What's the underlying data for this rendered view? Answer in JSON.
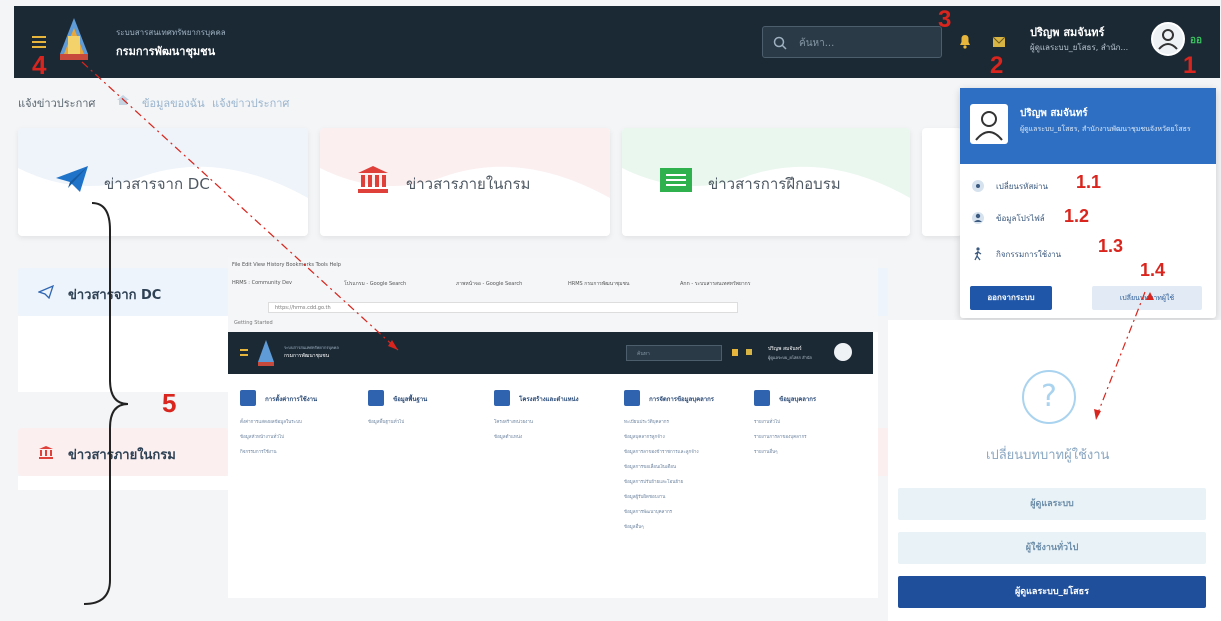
{
  "topbar": {
    "org_sub": "ระบบสารสนเทศทรัพยากรบุคคล",
    "org_name": "กรมการพัฒนาชุมชน",
    "search_placeholder": "ค้นหา...",
    "user_name": "ปริญพ สมจันทร์",
    "user_role": "ผู้ดูแลระบบ_ยโสธร, สำนัก...",
    "online_badge": "ออ"
  },
  "breadcrumb": {
    "current": "แจ้งข่าวประกาศ",
    "items": [
      "ข้อมูลของฉัน",
      "แจ้งข่าวประกาศ"
    ]
  },
  "cards": [
    {
      "label": "ข่าวสารจาก DC",
      "icon": "paper-plane-icon",
      "color": "#1f73c9"
    },
    {
      "label": "ข่าวสารภายในกรม",
      "icon": "bank-icon",
      "color": "#e0403a"
    },
    {
      "label": "ข่าวสารการฝึกอบรม",
      "icon": "list-icon",
      "color": "#2fb24d"
    }
  ],
  "panels": [
    {
      "label": "ข่าวสารจาก DC"
    },
    {
      "label": "ข่าวสารภายในกรม"
    }
  ],
  "dropdown": {
    "name": "ปริญพ สมจันทร์",
    "org": "ผู้ดูแลระบบ_ยโสธร, สำนักงานพัฒนาชุมชนจังหวัดยโสธร",
    "items": [
      {
        "label": "เปลี่ยนรหัสผ่าน",
        "icon": "gear-icon"
      },
      {
        "label": "ข้อมูลโปรไฟล์",
        "icon": "user-icon"
      },
      {
        "label": "กิจกรรมการใช้งาน",
        "icon": "walk-icon"
      }
    ],
    "logout": "ออกจากระบบ",
    "switch_role": "เปลี่ยนบทบาทผู้ใช้"
  },
  "role_panel": {
    "title": "เปลี่ยนบทบาทผู้ใช้งาน",
    "roles": [
      "ผู้ดูแลระบบ",
      "ผู้ใช้งานทั่วไป",
      "ผู้ดูแลระบบ_ยโสธร"
    ],
    "active_index": 2
  },
  "inner_screenshot": {
    "browser_menu": "File  Edit  View  History  Bookmarks  Tools  Help",
    "tabs": [
      "HRMS : Community Dev",
      "โปรแกรม - Google Search",
      "ภาพหน้าจอ - Google Search",
      "HRMS กรมการพัฒนาชุมชน",
      "Ann - ระบบสารสนเทศทรัพยากร"
    ],
    "url": "https://hrms.cdd.go.th",
    "bookmark": "Getting Started",
    "org_sub": "ระบบสารสนเทศทรัพยากรบุคคล",
    "org_name": "กรมการพัฒนาชุมชน",
    "search_placeholder": "ค้นหา",
    "user_name": "ปริญพ สมจันทร์",
    "user_role": "ผู้ดูแลระบบ_ยโสธร สำนัก",
    "menus": [
      {
        "head": "การตั้งค่าการใช้งาน",
        "items": [
          "ตั้งค่าการแสดงผลข้อมูลในระบบ",
          "ข้อมูลหัวหน้างานทั่วไป",
          "กิจกรรมการใช้งาน"
        ]
      },
      {
        "head": "ข้อมูลพื้นฐาน",
        "items": [
          "ข้อมูลพื้นฐานทั่วไป"
        ]
      },
      {
        "head": "โครงสร้างและตำแหน่ง",
        "items": [
          "โครงสร้างหน่วยงาน",
          "ข้อมูลตำแหน่ง"
        ]
      },
      {
        "head": "การจัดการข้อมูลบุคลากร",
        "items": [
          "ทะเบียนประวัติบุคลากร",
          "ข้อมูลบุคลากรลูกจ้าง",
          "ข้อมูลการลาของข้าราชการและลูกจ้าง",
          "ข้อมูลการขอเลื่อนเงินเดือน",
          "ข้อมูลการปรับย้ายและโอนย้าย",
          "ข้อมูลผู้รับผิดชอบงาน",
          "ข้อมูลการพัฒนาบุคลากร",
          "ข้อมูลอื่นๆ"
        ]
      },
      {
        "head": "ข้อมูลบุคลากร",
        "items": [
          "รายงานทั่วไป",
          "รายงานการลาของบุคลากร",
          "รายงานอื่นๆ"
        ]
      }
    ]
  },
  "annotations": [
    "1",
    "1.1",
    "1.2",
    "1.3",
    "1.4",
    "2",
    "3",
    "4",
    "5"
  ]
}
